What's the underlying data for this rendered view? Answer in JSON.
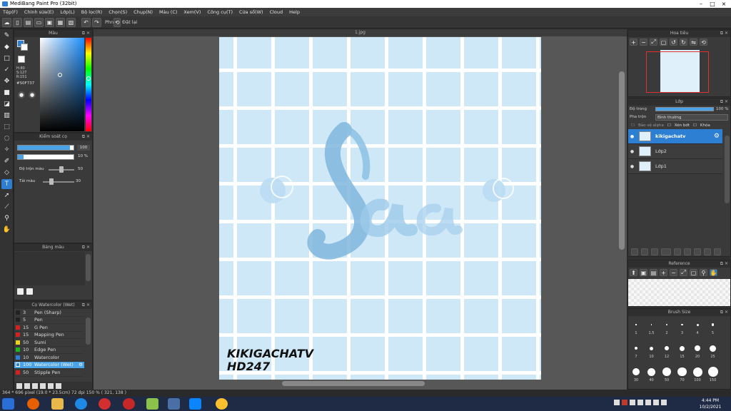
{
  "window": {
    "title": "MediBang Paint Pro (32bit)"
  },
  "menu": [
    "Tệp(F)",
    "Chỉnh sửa(E)",
    "Lớp(L)",
    "Bộ lọc(R)",
    "Chọn(S)",
    "Chụp(N)",
    "Màu (C)",
    "Xem(V)",
    "Công cụ(T)",
    "Cửa sổ(W)",
    "Cloud",
    "Help"
  ],
  "toolbar": {
    "hand_label": "Phn",
    "rotate_label": "Đặt lại"
  },
  "color_panel": {
    "title": "Màu",
    "readout": [
      "H:80",
      "S:127",
      "R:151"
    ],
    "hex": "#S0F737"
  },
  "brush_control": {
    "title": "Kiểm soát cọ",
    "size_value": "100",
    "opacity_value": "10 %",
    "blend_label": "Độ trộn màu",
    "blend_value": "50",
    "density_label": "Tải màu",
    "density_value": "30"
  },
  "palette": {
    "title": "Bảng màu"
  },
  "brush_list": {
    "title": "Cọ Watercolor (Wet)",
    "items": [
      {
        "size": "3",
        "name": "Pen (Sharp)",
        "color": "#222222"
      },
      {
        "size": "5",
        "name": "Pen",
        "color": "#222222"
      },
      {
        "size": "15",
        "name": "G Pen",
        "color": "#d22222"
      },
      {
        "size": "15",
        "name": "Mapping Pen",
        "color": "#d22222"
      },
      {
        "size": "50",
        "name": "Sumi",
        "color": "#e8d21e"
      },
      {
        "size": "10",
        "name": "Edge Pen",
        "color": "#1fb21f"
      },
      {
        "size": "10",
        "name": "Watercolor",
        "color": "#2d7fd3"
      },
      {
        "size": "100",
        "name": "Watercolor (Wet)",
        "color": "#2d7fd3"
      },
      {
        "size": "50",
        "name": "Stipple Pen",
        "color": "#d22222"
      }
    ]
  },
  "document": {
    "tab": "1.jpg",
    "watermark_line1": "KIKIGACHATV",
    "watermark_line2": "HD247"
  },
  "navigator": {
    "title": "Hoa tiêu"
  },
  "layers_panel": {
    "title": "Lớp",
    "opacity_label": "Độ trong",
    "opacity_value": "100 %",
    "blend_label": "Pha trộn",
    "blend_value": "Bình thường",
    "protect_alpha": "Bảo vệ alpha",
    "clip": "Xén bớt",
    "lock": "Khóa",
    "layers": [
      "kikigachatv",
      "Lớp2",
      "Lớp1"
    ]
  },
  "reference": {
    "title": "Reference"
  },
  "brush_size_panel": {
    "title": "Brush Size",
    "sizes": [
      "1",
      "1.5",
      "2",
      "3",
      "4",
      "5",
      "7",
      "10",
      "12",
      "15",
      "20",
      "25",
      "30",
      "40",
      "50",
      "70",
      "100",
      "150"
    ]
  },
  "status": {
    "text": "364 * 696 pixel   (19.0 * 23.5cm)   72 dpi   150 %   ( 321, 138 )"
  },
  "clock": {
    "time": "4:44 PM",
    "date": "10/2/2021"
  },
  "colors": {
    "accent": "#2d7fd3",
    "canvas": "#cfe8f7",
    "grid": "#ffffff"
  }
}
